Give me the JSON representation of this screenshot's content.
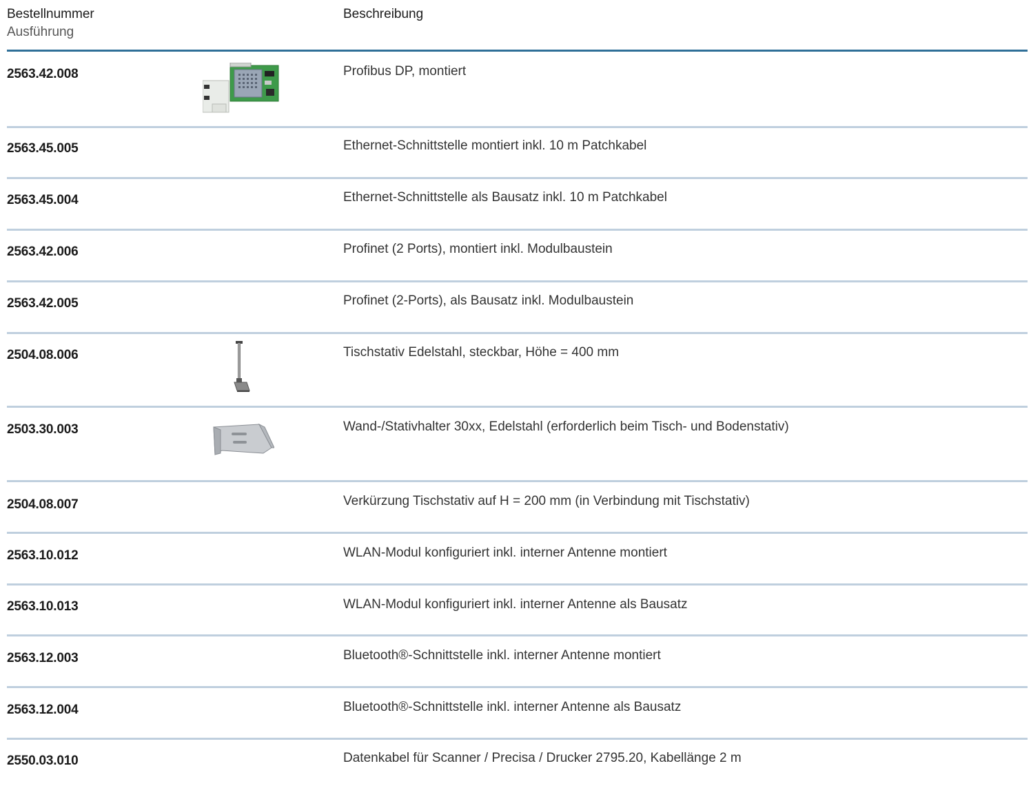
{
  "header": {
    "col_number": "Bestellnummer",
    "col_variant": "Ausführung",
    "col_description": "Beschreibung"
  },
  "rows": [
    {
      "number": "2563.42.008",
      "description": "Profibus DP, montiert",
      "image": "profibus-module-icon"
    },
    {
      "number": "2563.45.005",
      "description": "Ethernet-Schnittstelle montiert inkl. 10 m Patchkabel"
    },
    {
      "number": "2563.45.004",
      "description": "Ethernet-Schnittstelle als Bausatz inkl. 10 m Patchkabel"
    },
    {
      "number": "2563.42.006",
      "description": "Profinet (2 Ports), montiert inkl. Modulbaustein"
    },
    {
      "number": "2563.42.005",
      "description": "Profinet (2-Ports), als Bausatz inkl. Modulbaustein"
    },
    {
      "number": "2504.08.006",
      "description": "Tischstativ Edelstahl, steckbar, Höhe = 400 mm",
      "image": "table-stand-icon"
    },
    {
      "number": "2503.30.003",
      "description": "Wand-/Stativhalter 30xx, Edelstahl (erforderlich beim Tisch- und Bodenstativ)",
      "image": "wall-bracket-icon"
    },
    {
      "number": "2504.08.007",
      "description": "Verkürzung Tischstativ auf H = 200 mm (in Verbindung mit Tischstativ)"
    },
    {
      "number": "2563.10.012",
      "description": "WLAN-Modul konfiguriert inkl. interner Antenne montiert"
    },
    {
      "number": "2563.10.013",
      "description": "WLAN-Modul konfiguriert inkl. interner Antenne als Bausatz"
    },
    {
      "number": "2563.12.003",
      "description": "Bluetooth®-Schnittstelle inkl. interner Antenne montiert"
    },
    {
      "number": "2563.12.004",
      "description": "Bluetooth®-Schnittstelle inkl. interner Antenne als Bausatz"
    },
    {
      "number": "2550.03.010",
      "description": "Datenkabel für Scanner / Precisa / Drucker 2795.20, Kabellänge 2 m"
    }
  ],
  "colors": {
    "header_rule": "#2f6f98",
    "row_rule": "#bfcfde"
  }
}
